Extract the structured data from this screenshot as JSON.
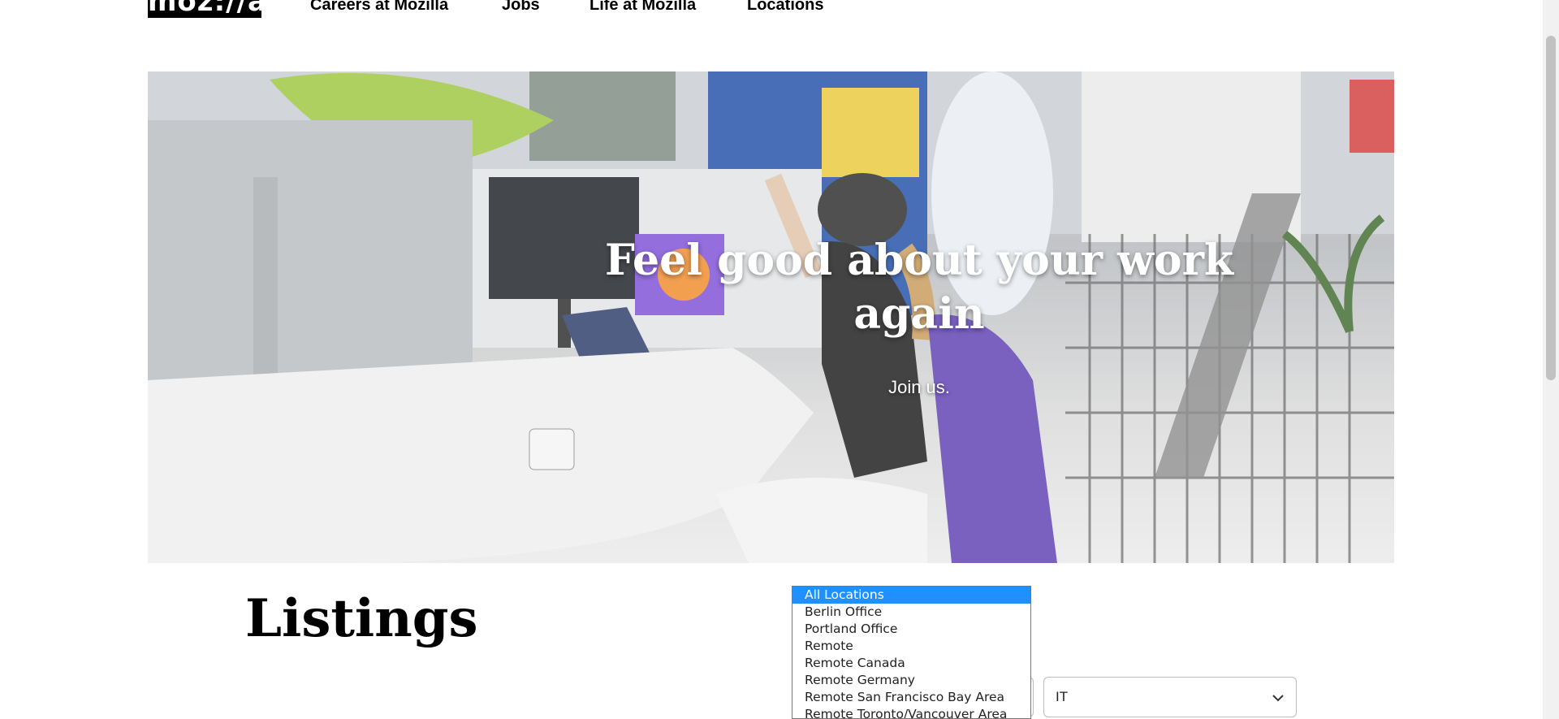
{
  "header": {
    "logo_text": "moz://a",
    "nav": [
      {
        "label": "Careers at Mozilla"
      },
      {
        "label": "Jobs"
      },
      {
        "label": "Life at Mozilla"
      },
      {
        "label": "Locations"
      }
    ]
  },
  "hero": {
    "title": "Feel good about your work again",
    "subtitle": "Join us."
  },
  "listings": {
    "title": "Listings",
    "location_select": {
      "options": [
        "All Locations",
        "Berlin Office",
        "Portland Office",
        "Remote",
        "Remote Canada",
        "Remote Germany",
        "Remote San Francisco Bay Area",
        "Remote Toronto/Vancouver Area"
      ],
      "selected_index": 0
    },
    "department_select": {
      "value": "IT"
    }
  },
  "colors": {
    "accent_selected": "#1e90ff",
    "logo_bg": "#000000"
  },
  "icons": [
    "chevron-down-icon"
  ]
}
